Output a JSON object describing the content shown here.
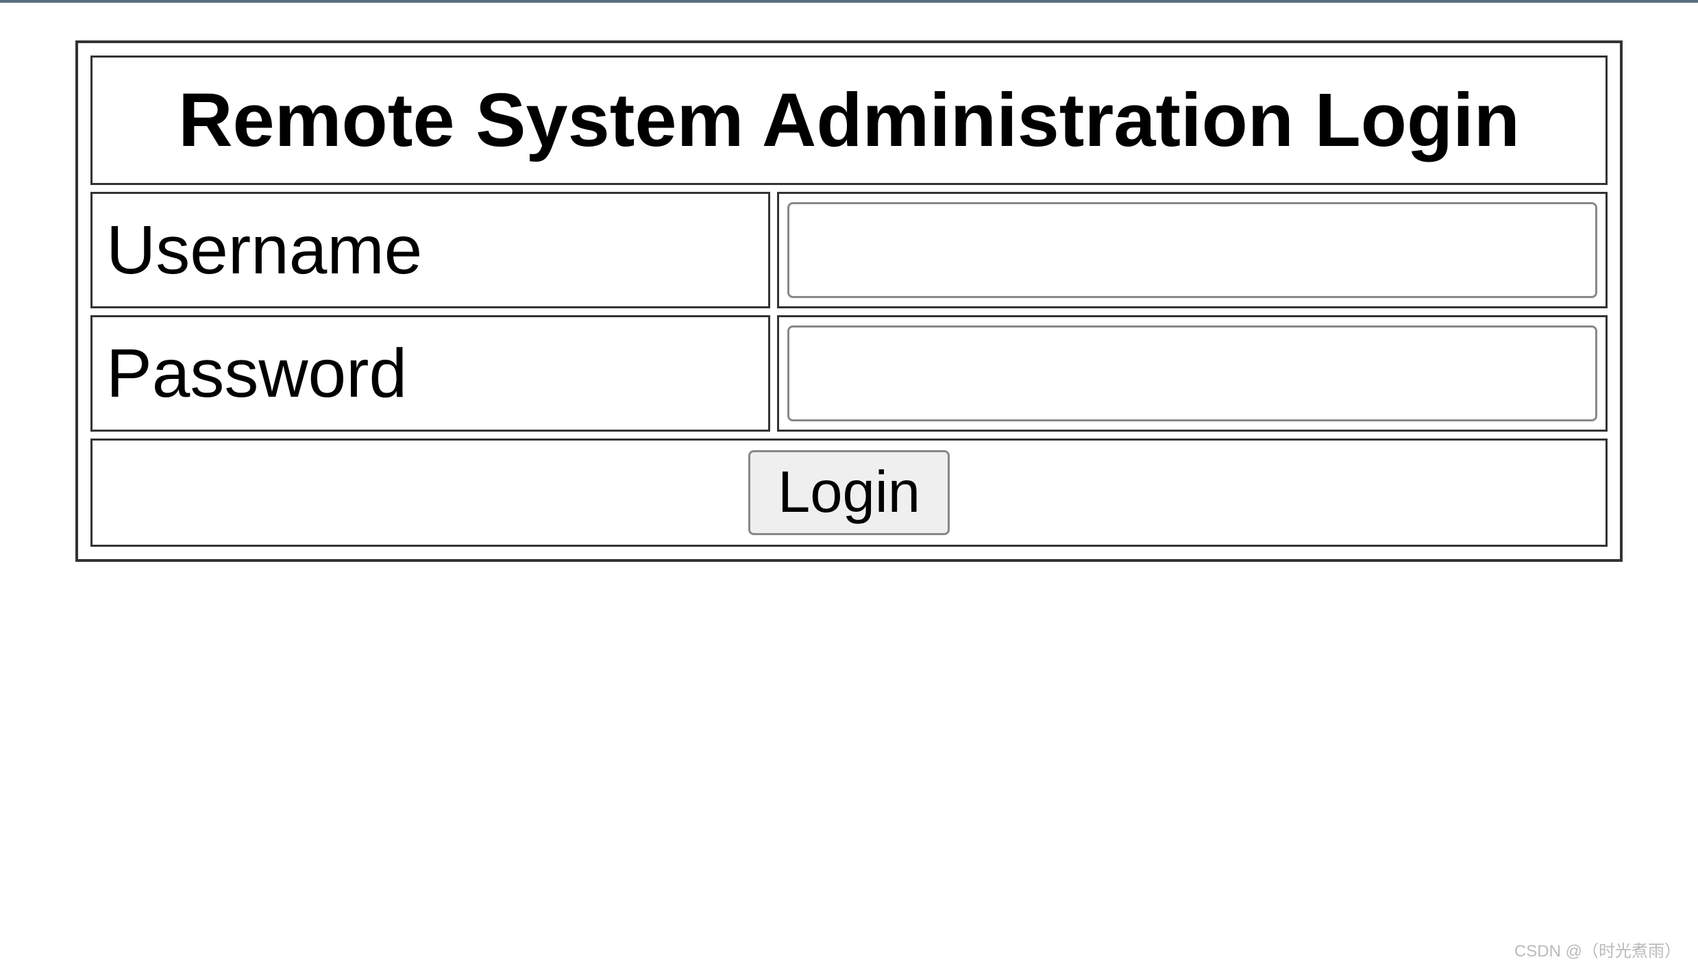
{
  "form": {
    "title": "Remote System Administration Login",
    "username_label": "Username",
    "username_value": "",
    "password_label": "Password",
    "password_value": "",
    "login_button_label": "Login"
  },
  "watermark": "CSDN @（时光煮雨）"
}
